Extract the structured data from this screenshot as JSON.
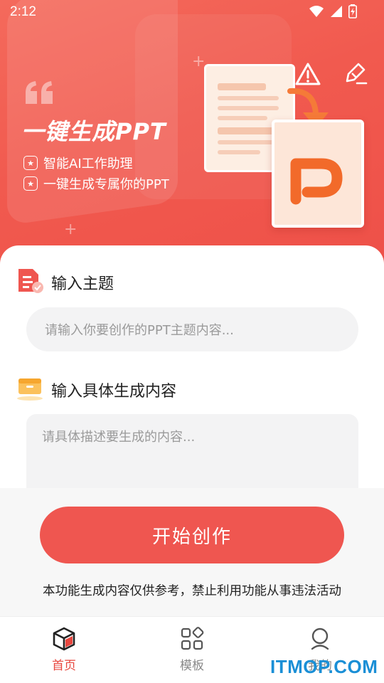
{
  "status_bar": {
    "time": "2:12"
  },
  "hero": {
    "title": "一键生成PPT",
    "features": [
      "智能AI工作助理",
      "一键生成专属你的PPT"
    ]
  },
  "topic_section": {
    "label": "输入主题",
    "placeholder": "请输入你要创作的PPT主题内容..."
  },
  "content_section": {
    "label": "输入具体生成内容",
    "placeholder": "请具体描述要生成的内容..."
  },
  "start_button": {
    "label": "开始创作"
  },
  "disclaimer": "本功能生成内容仅供参考，禁止利用功能从事违法活动",
  "tabs": [
    {
      "label": "首页",
      "icon": "home-cube-icon",
      "active": true
    },
    {
      "label": "模板",
      "icon": "template-grid-icon",
      "active": false
    },
    {
      "label": "我的",
      "icon": "profile-icon",
      "active": false
    }
  ],
  "watermark": "ITMOP.COM",
  "colors": {
    "accent": "#ef5650",
    "active_tab": "#e8473f",
    "inactive_tab": "#888888"
  }
}
